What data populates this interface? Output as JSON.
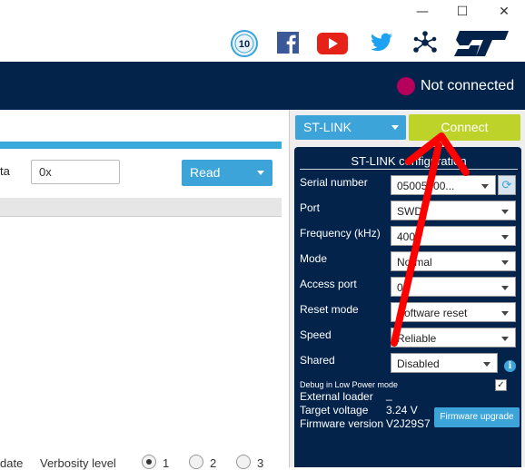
{
  "window_controls": {
    "minimize": "—",
    "maximize": "☐",
    "close": "✕"
  },
  "header_icons": [
    "anniversary-10-years-icon",
    "facebook-icon",
    "youtube-icon",
    "twitter-icon",
    "network-share-icon",
    "st-logo-icon"
  ],
  "connection": {
    "status": "Not connected",
    "status_color": "#b5005c"
  },
  "left_panel": {
    "address_label": "ta",
    "address_value": "0x",
    "read_button": "Read",
    "bottom_label": "date",
    "verbosity_label": "Verbosity level",
    "verbosity_options": [
      "1",
      "2",
      "3"
    ],
    "verbosity_selected": "1"
  },
  "probe": {
    "interface_select": "ST-LINK",
    "connect_button": "Connect"
  },
  "config": {
    "title": "ST-LINK configuration",
    "fields": [
      {
        "label": "Serial number",
        "value": "05005400..."
      },
      {
        "label": "Port",
        "value": "SWD"
      },
      {
        "label": "Frequency (kHz)",
        "value": "4000"
      },
      {
        "label": "Mode",
        "value": "Normal"
      },
      {
        "label": "Access port",
        "value": "0"
      },
      {
        "label": "Reset mode",
        "value": "Software reset"
      },
      {
        "label": "Speed",
        "value": "Reliable"
      },
      {
        "label": "Shared",
        "value": "Disabled"
      }
    ],
    "debug_low_power_label": "Debug in Low Power mode",
    "debug_low_power_checked": true,
    "external_loader_label": "External loader",
    "external_loader_value": "_",
    "target_voltage_label": "Target voltage",
    "target_voltage_value": "3.24 V",
    "firmware_version_label": "Firmware version",
    "firmware_version_value": "V2J29S7",
    "firmware_upgrade_button": "Firmware upgrade"
  },
  "colors": {
    "header_bar": "#03234b",
    "accent_blue": "#3ca4d8",
    "connect_green": "#bed32a",
    "annotation_arrow": "#ff0000"
  }
}
